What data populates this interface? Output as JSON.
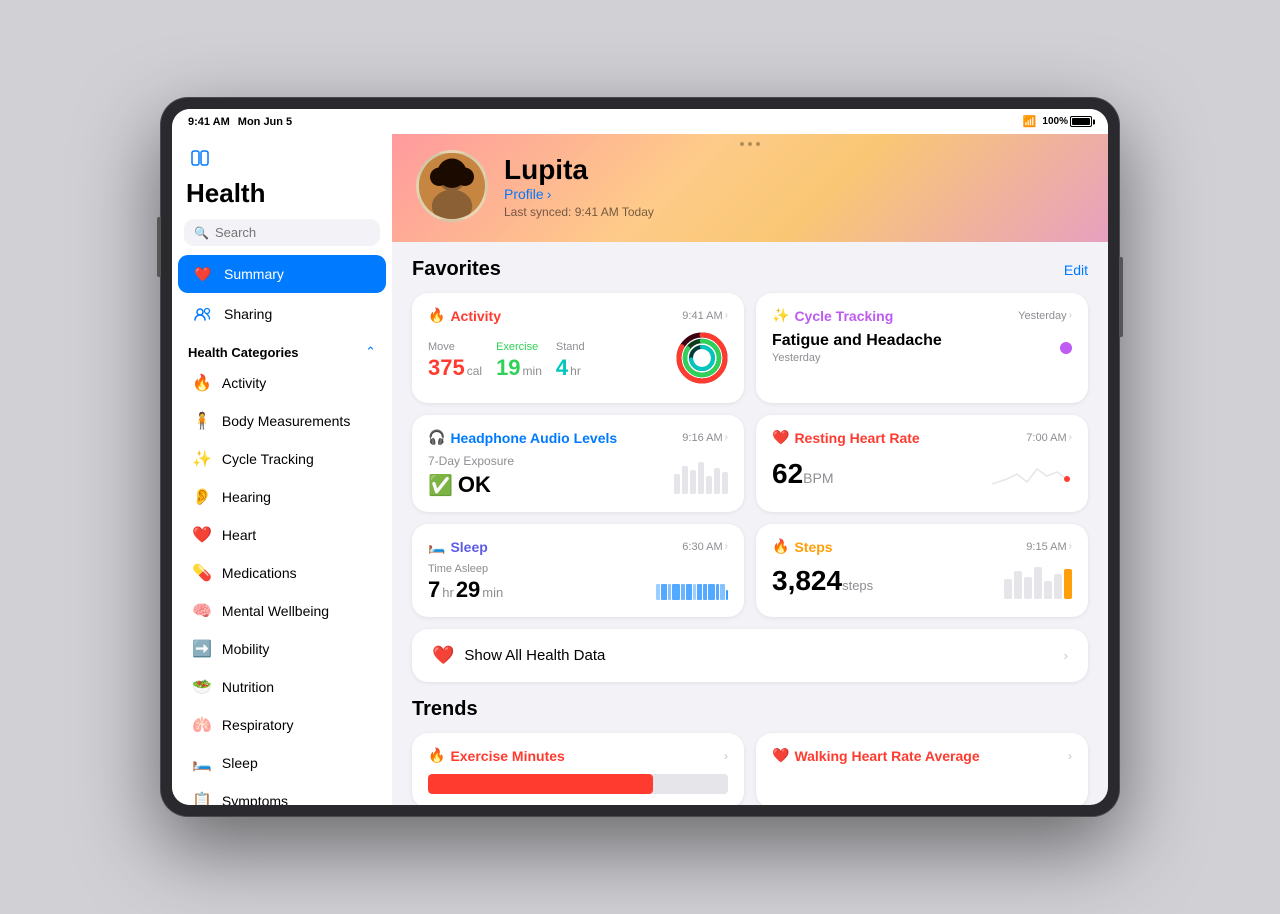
{
  "status_bar": {
    "time": "9:41 AM",
    "date": "Mon Jun 5",
    "wifi": "WiFi",
    "battery_pct": "100%"
  },
  "sidebar": {
    "title": "Health",
    "search_placeholder": "Search",
    "toggle_icon": "sidebar-icon",
    "nav_items": [
      {
        "id": "summary",
        "label": "Summary",
        "icon": "❤️",
        "active": true,
        "icon_color": "#fff"
      },
      {
        "id": "sharing",
        "label": "Sharing",
        "icon": "👥",
        "active": false
      }
    ],
    "categories_label": "Health Categories",
    "categories": [
      {
        "id": "activity",
        "label": "Activity",
        "icon": "🔥",
        "color": "#ff3b30"
      },
      {
        "id": "body-measurements",
        "label": "Body Measurements",
        "icon": "🧍",
        "color": "#ff6b35"
      },
      {
        "id": "cycle-tracking",
        "label": "Cycle Tracking",
        "icon": "✨",
        "color": "#bf5af2"
      },
      {
        "id": "hearing",
        "label": "Hearing",
        "icon": "👂",
        "color": "#ff9f0a"
      },
      {
        "id": "heart",
        "label": "Heart",
        "icon": "❤️",
        "color": "#ff3b30"
      },
      {
        "id": "medications",
        "label": "Medications",
        "icon": "💊",
        "color": "#32ade6"
      },
      {
        "id": "mental-wellbeing",
        "label": "Mental Wellbeing",
        "icon": "🧠",
        "color": "#30d158"
      },
      {
        "id": "mobility",
        "label": "Mobility",
        "icon": "➡️",
        "color": "#ff9f0a"
      },
      {
        "id": "nutrition",
        "label": "Nutrition",
        "icon": "🥗",
        "color": "#30d158"
      },
      {
        "id": "respiratory",
        "label": "Respiratory",
        "icon": "🫁",
        "color": "#32ade6"
      },
      {
        "id": "sleep",
        "label": "Sleep",
        "icon": "🛏️",
        "color": "#5e5ce6"
      },
      {
        "id": "symptoms",
        "label": "Symptoms",
        "icon": "📋",
        "color": "#ff9f0a"
      }
    ]
  },
  "profile": {
    "name": "Lupita",
    "profile_label": "Profile",
    "sync_label": "Last synced: 9:41 AM Today",
    "avatar_emoji": "👩🏾"
  },
  "favorites": {
    "title": "Favorites",
    "edit_label": "Edit",
    "activity_card": {
      "title": "Activity",
      "time": "9:41 AM",
      "move_label": "Move",
      "move_value": "375",
      "move_unit": "cal",
      "exercise_label": "Exercise",
      "exercise_value": "19",
      "exercise_unit": "min",
      "stand_label": "Stand",
      "stand_value": "4",
      "stand_unit": "hr"
    },
    "cycle_card": {
      "title": "Cycle Tracking",
      "time": "Yesterday",
      "symptom": "Fatigue and Headache",
      "symptom_date": "Yesterday"
    },
    "headphone_card": {
      "title": "Headphone Audio Levels",
      "time": "9:16 AM",
      "sub_label": "7-Day Exposure",
      "status": "OK"
    },
    "heart_rate_card": {
      "title": "Resting Heart Rate",
      "time": "7:00 AM",
      "value": "62",
      "unit": "BPM"
    },
    "sleep_card": {
      "title": "Sleep",
      "time": "6:30 AM",
      "sub_label": "Time Asleep",
      "hours": "7",
      "minutes": "29",
      "hours_unit": "hr",
      "minutes_unit": "min"
    },
    "steps_card": {
      "title": "Steps",
      "time": "9:15 AM",
      "value": "3,824",
      "unit": "steps"
    }
  },
  "show_all": {
    "label": "Show All Health Data"
  },
  "trends": {
    "title": "Trends",
    "exercise_minutes": {
      "title": "Exercise Minutes"
    },
    "walking_heart_rate": {
      "title": "Walking Heart Rate Average"
    }
  }
}
